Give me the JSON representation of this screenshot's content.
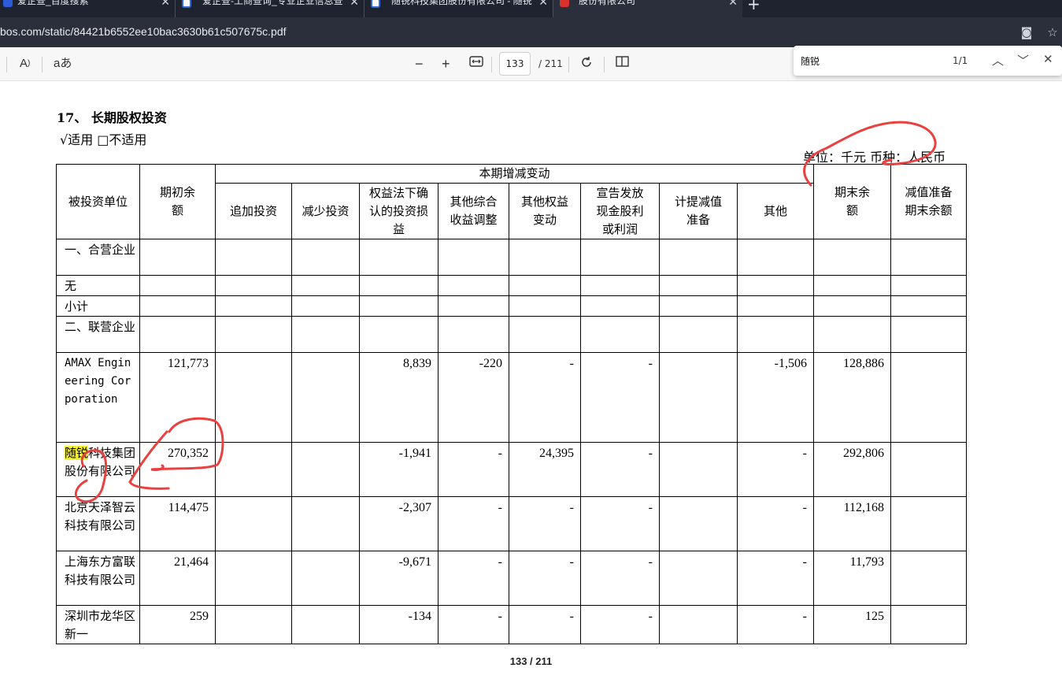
{
  "browser": {
    "tabs": [
      {
        "title": "爱企查_百度搜索"
      },
      {
        "title": "爱企查-工商查询_专业企业信息查"
      },
      {
        "title": "随锐科技集团股份有限公司 - 随锐"
      },
      {
        "title": "股份有限公司"
      }
    ],
    "url": "bos.com/static/84421b6552ee10bac3630b61c507675c.pdf"
  },
  "pdf_toolbar": {
    "read_aloud": "A",
    "text_options": "aあ",
    "zoom_out": "−",
    "zoom_in": "+",
    "current_page": "133",
    "total_pages": "/ 211"
  },
  "find": {
    "query": "随锐",
    "count": "1/1"
  },
  "document": {
    "heading": "17、 长期股权投资",
    "applicability": "√适用  □不适用",
    "unit_line": "单位：千元   币种：人民币",
    "headers": {
      "investee": "被投资单位",
      "opening": "期初余额",
      "period_change": "本期增减变动",
      "sub": [
        "追加投资",
        "减少投资",
        "权益法下确认的投资损益",
        "其他综合收益调整",
        "其他权益变动",
        "宣告发放现金股利或利润",
        "计提减值准备",
        "其他"
      ],
      "closing": "期末余额",
      "impairment_closing": "减值准备期末余额"
    },
    "section_rows": [
      {
        "name": "一、合营企业"
      },
      {
        "name": "无"
      },
      {
        "name": "小计"
      },
      {
        "name": "二、联营企业"
      }
    ],
    "rows": [
      {
        "name": "AMAX Engineering Corporation",
        "opening": "121,773",
        "add": "",
        "reduce": "",
        "equity_pl": "8,839",
        "oci": "-220",
        "other_equity": "-",
        "dividend": "-",
        "impairment": "",
        "other": "-1,506",
        "closing": "128,886",
        "imp_close": ""
      },
      {
        "name_hl": "随锐",
        "name_rest": "科技集团股份有限公司",
        "opening": "270,352",
        "add": "",
        "reduce": "",
        "equity_pl": "-1,941",
        "oci": "-",
        "other_equity": "24,395",
        "dividend": "-",
        "impairment": "",
        "other": "-",
        "closing": "292,806",
        "imp_close": ""
      },
      {
        "name": "北京天泽智云科技有限公司",
        "opening": "114,475",
        "add": "",
        "reduce": "",
        "equity_pl": "-2,307",
        "oci": "-",
        "other_equity": "-",
        "dividend": "-",
        "impairment": "",
        "other": "-",
        "closing": "112,168",
        "imp_close": ""
      },
      {
        "name": "上海东方富联科技有限公司",
        "opening": "21,464",
        "add": "",
        "reduce": "",
        "equity_pl": "-9,671",
        "oci": "-",
        "other_equity": "-",
        "dividend": "-",
        "impairment": "",
        "other": "-",
        "closing": "11,793",
        "imp_close": ""
      },
      {
        "name": "深圳市龙华区新一",
        "opening": "259",
        "add": "",
        "reduce": "",
        "equity_pl": "-134",
        "oci": "-",
        "other_equity": "-",
        "dividend": "-",
        "impairment": "",
        "other": "-",
        "closing": "125",
        "imp_close": ""
      }
    ],
    "page_footer": "133 / 211"
  },
  "colors": {
    "find_highlight": "#f5ef34",
    "annotation_ink": "#e8413f",
    "tab_strip": "#1f2330"
  }
}
